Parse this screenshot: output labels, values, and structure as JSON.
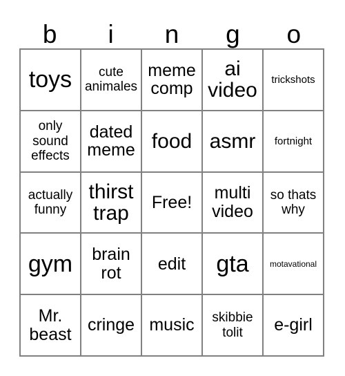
{
  "card": {
    "type": "bingo-card",
    "columns": 5,
    "rows": 5,
    "border_color": "#808080",
    "background_color": "#ffffff",
    "text_color": "#000000"
  },
  "header": {
    "letters": [
      "b",
      "i",
      "n",
      "g",
      "o"
    ]
  },
  "grid": {
    "rows": [
      [
        {
          "text": "toys",
          "size": "xl"
        },
        {
          "text": "cute animales",
          "size": "sm"
        },
        {
          "text": "meme comp",
          "size": "md"
        },
        {
          "text": "ai video",
          "size": "lg"
        },
        {
          "text": "trickshots",
          "size": "xs"
        }
      ],
      [
        {
          "text": "only sound effects",
          "size": "sm"
        },
        {
          "text": "dated meme",
          "size": "md"
        },
        {
          "text": "food",
          "size": "lg"
        },
        {
          "text": "asmr",
          "size": "lg"
        },
        {
          "text": "fortnight",
          "size": "xs"
        }
      ],
      [
        {
          "text": "actually funny",
          "size": "sm"
        },
        {
          "text": "thirst trap",
          "size": "lg"
        },
        {
          "text": "Free!",
          "size": "md"
        },
        {
          "text": "multi video",
          "size": "md"
        },
        {
          "text": "so thats why",
          "size": "sm"
        }
      ],
      [
        {
          "text": "gym",
          "size": "xl"
        },
        {
          "text": "brain rot",
          "size": "md"
        },
        {
          "text": "edit",
          "size": "md"
        },
        {
          "text": "gta",
          "size": "xl"
        },
        {
          "text": "motavational",
          "size": "xxs"
        }
      ],
      [
        {
          "text": "Mr. beast",
          "size": "md"
        },
        {
          "text": "cringe",
          "size": "md"
        },
        {
          "text": "music",
          "size": "md"
        },
        {
          "text": "skibbie tolit",
          "size": "sm"
        },
        {
          "text": "e-girl",
          "size": "md"
        }
      ]
    ]
  }
}
